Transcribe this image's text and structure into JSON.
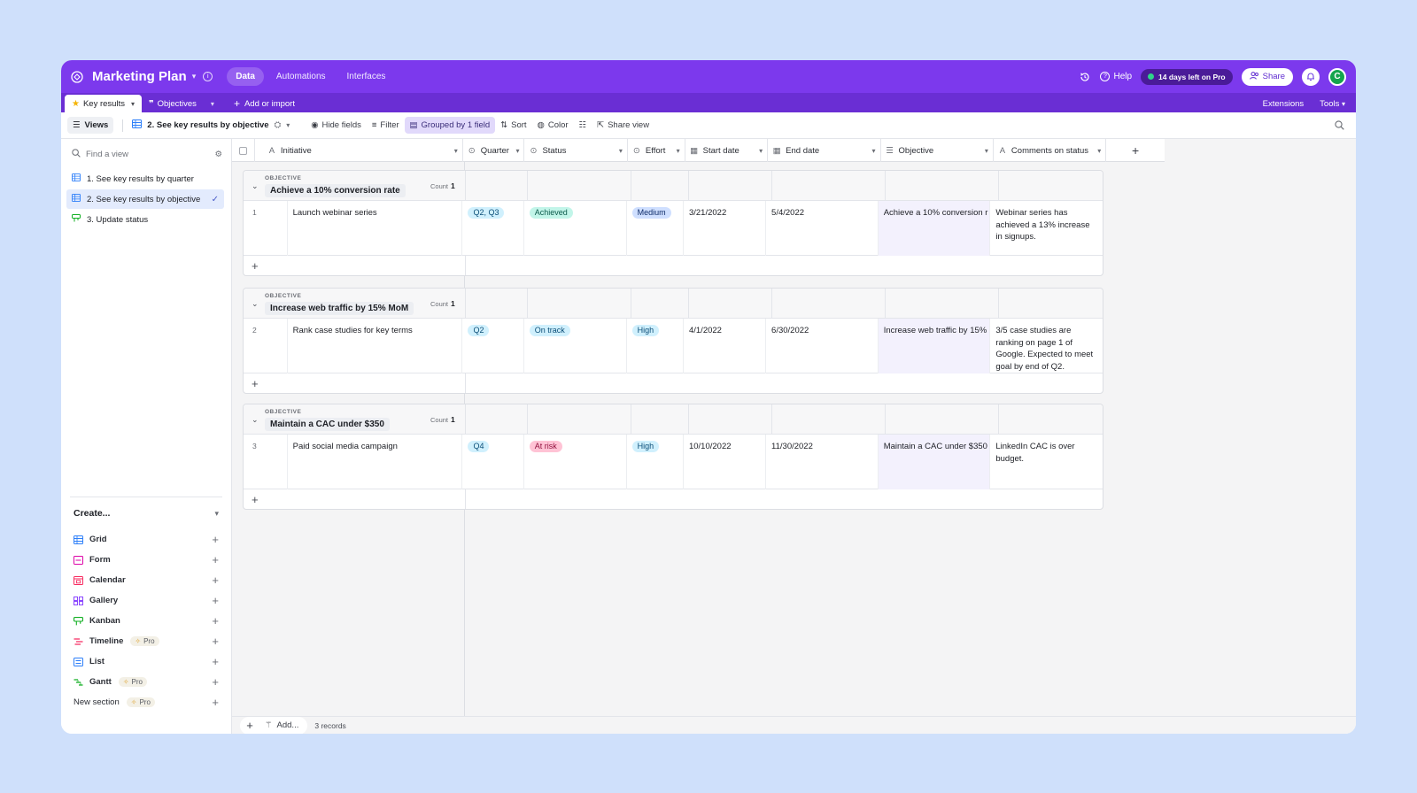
{
  "app": {
    "title": "Marketing Plan",
    "nav": [
      "Data",
      "Automations",
      "Interfaces"
    ],
    "active_nav": "Data",
    "help_label": "Help",
    "trial_label": "14 days left on Pro",
    "share_label": "Share",
    "avatar_initial": "C",
    "accent": "#7c39ed"
  },
  "tabs": {
    "items": [
      {
        "label": "Key results",
        "icon": "star-icon"
      },
      {
        "label": "Objectives",
        "icon": "quote-icon"
      }
    ],
    "add_label": "Add or import",
    "right": [
      "Extensions",
      "Tools"
    ]
  },
  "viewbar": {
    "views_label": "Views",
    "current_view": "2. See key results by objective",
    "tools": [
      "Hide fields",
      "Filter",
      "Grouped by 1 field",
      "Sort",
      "Color",
      "Share view"
    ]
  },
  "sidebar": {
    "find_placeholder": "Find a view",
    "views": [
      {
        "label": "1. See key results by quarter",
        "icon": "grid-icon"
      },
      {
        "label": "2. See key results by objective",
        "icon": "grid-icon",
        "active": true
      },
      {
        "label": "3. Update status",
        "icon": "kanban-icon"
      }
    ],
    "create_label": "Create...",
    "create_items": [
      {
        "label": "Grid",
        "icon": "grid-icon",
        "color": "#2d7ff9"
      },
      {
        "label": "Form",
        "icon": "form-icon",
        "color": "#dd04a8"
      },
      {
        "label": "Calendar",
        "icon": "calendar-icon",
        "color": "#f82b60"
      },
      {
        "label": "Gallery",
        "icon": "gallery-icon",
        "color": "#8b46ff"
      },
      {
        "label": "Kanban",
        "icon": "kanban-icon",
        "color": "#11af22"
      },
      {
        "label": "Timeline",
        "icon": "timeline-icon",
        "color": "#f82b60",
        "pro": "Pro"
      },
      {
        "label": "List",
        "icon": "list-icon",
        "color": "#2d7ff9"
      },
      {
        "label": "Gantt",
        "icon": "gantt-icon",
        "color": "#11af22",
        "pro": "Pro"
      },
      {
        "label": "New section",
        "icon": "",
        "pro": "Pro"
      }
    ]
  },
  "columns": [
    "Initiative",
    "Quarter",
    "Status",
    "Effort",
    "Start date",
    "End date",
    "Objective",
    "Comments on status"
  ],
  "group_label": "OBJECTIVE",
  "count_label": "Count",
  "groups": [
    {
      "title": "Achieve a 10% conversion rate",
      "count": "1",
      "row": {
        "num": "1",
        "initiative": "Launch webinar series",
        "quarter": [
          "Q2, Q3"
        ],
        "status": "Achieved",
        "effort": "Medium",
        "start": "3/21/2022",
        "end": "5/4/2022",
        "objective": "Achieve a 10% conversion r",
        "comments": "Webinar series has achieved a 13% increase in signups."
      }
    },
    {
      "title": "Increase web traffic by 15% MoM",
      "count": "1",
      "row": {
        "num": "2",
        "initiative": "Rank case studies for key terms",
        "quarter": [
          "Q2"
        ],
        "status": "On track",
        "effort": "High",
        "start": "4/1/2022",
        "end": "6/30/2022",
        "objective": "Increase web traffic by 15%",
        "comments": "3/5 case studies are ranking on page 1 of Google. Expected to meet goal by end of Q2."
      }
    },
    {
      "title": "Maintain a CAC under $350",
      "count": "1",
      "row": {
        "num": "3",
        "initiative": "Paid social media campaign",
        "quarter": [
          "Q4"
        ],
        "status": "At risk",
        "effort": "High",
        "start": "10/10/2022",
        "end": "11/30/2022",
        "objective": "Maintain a CAC under $350",
        "comments": "LinkedIn CAC is over budget."
      }
    }
  ],
  "footer": {
    "add_label": "Add...",
    "records": "3 records"
  }
}
